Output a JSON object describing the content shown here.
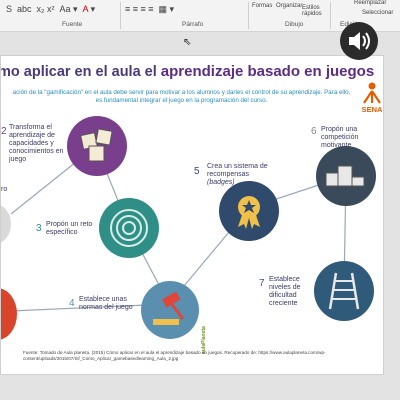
{
  "ribbon": {
    "fuente_label": "Fuente",
    "parrafo_label": "Párrafo",
    "dibujo_label": "Dibujo",
    "edicion_label": "Edición",
    "formas_label": "Formas",
    "organizar_label": "Organizar",
    "estilos_label": "Estilos rápidos",
    "seleccionar_label": "Seleccionar",
    "reemplazar_label": "Reemplazar"
  },
  "slide": {
    "title_part1": "mo aplicar en el aula el",
    "title_part2": "aprendizaje basado en juegos",
    "subtitle": "ación de la \"gamificación\" en el aula debe servir para motivar a los alumnos y darles el control de su aprendizaje. Para ello, es fundamental integrar el juego en la programación del curso.",
    "logo_text": "SENA",
    "items": [
      {
        "num": "2",
        "label": "Transforma el aprendizaje de capacidades y conocimientos en juego"
      },
      {
        "num": "3",
        "label": "Propón un reto específico"
      },
      {
        "num": "4",
        "label": "Establece unas normas del juego"
      },
      {
        "num": "5",
        "label": "Crea un sistema de recompensas",
        "sub": "(badges)"
      },
      {
        "num": "6",
        "label": "Propón una competición motivante"
      },
      {
        "num": "7",
        "label": "Establece niveles de dificultad creciente"
      }
    ],
    "partial_left": "ro",
    "vertical_brand": "aulaPlaneta",
    "source": "Fuente: Tomado de Aula planeta. (2015) Cómo aplicar en el aula el aprendizaje basado en juegos. Recuperado de: https://www.aulaplaneta.com/wp-content/uploads/2015/07/Inf_Como_Aplicar_gamebasedlearning_Aula_2.jpg"
  },
  "colors": {
    "purple": "#7a3f8c",
    "teal": "#2f8f86",
    "blue": "#5b8fb0",
    "navy": "#2f4a6a",
    "red": "#d9452c",
    "sena_green": "#39a900"
  }
}
